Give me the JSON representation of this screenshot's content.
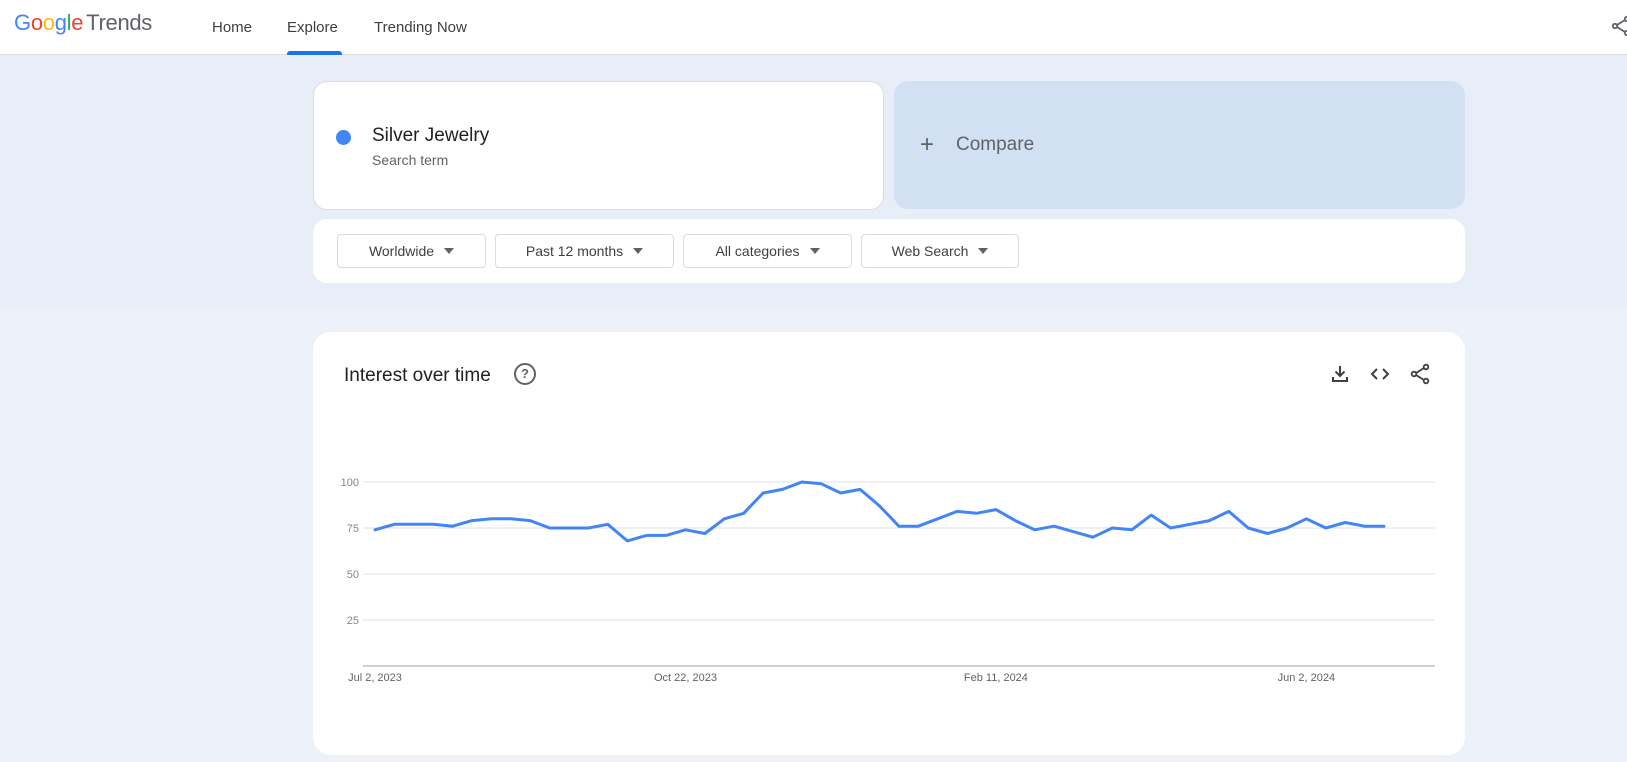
{
  "app": {
    "logo_google": "Google",
    "logo_trends": "Trends"
  },
  "nav": {
    "home": "Home",
    "explore": "Explore",
    "trending": "Trending Now"
  },
  "search": {
    "term": "Silver Jewelry",
    "term_type": "Search term",
    "compare_label": "Compare"
  },
  "filters": {
    "region": "Worldwide",
    "time_range": "Past 12 months",
    "category": "All categories",
    "search_type": "Web Search"
  },
  "chart_section": {
    "title": "Interest over time"
  },
  "icons": [
    "share-icon",
    "plus-icon",
    "help-icon",
    "download-icon",
    "embed-code-icon",
    "share-icon"
  ],
  "colors": {
    "accent": "#1a73e8",
    "series": "#4285f4",
    "compare_bg": "#d2e0f3"
  },
  "chart_data": {
    "type": "line",
    "title": "",
    "xlabel": "",
    "ylabel": "",
    "ylim": [
      0,
      100
    ],
    "y_ticks": [
      25,
      50,
      75,
      100
    ],
    "x_tick_labels": [
      "Jul 2, 2023",
      "Oct 22, 2023",
      "Feb 11, 2024",
      "Jun 2, 2024"
    ],
    "grid": true,
    "series": [
      {
        "name": "Silver Jewelry",
        "values": [
          74,
          77,
          77,
          77,
          76,
          79,
          80,
          80,
          79,
          75,
          75,
          75,
          77,
          68,
          71,
          71,
          74,
          72,
          80,
          83,
          94,
          96,
          100,
          99,
          94,
          96,
          87,
          76,
          76,
          80,
          84,
          83,
          85,
          79,
          74,
          76,
          73,
          70,
          75,
          74,
          82,
          75,
          77,
          79,
          84,
          75,
          72,
          75,
          80,
          75,
          78,
          76,
          76
        ]
      }
    ]
  }
}
